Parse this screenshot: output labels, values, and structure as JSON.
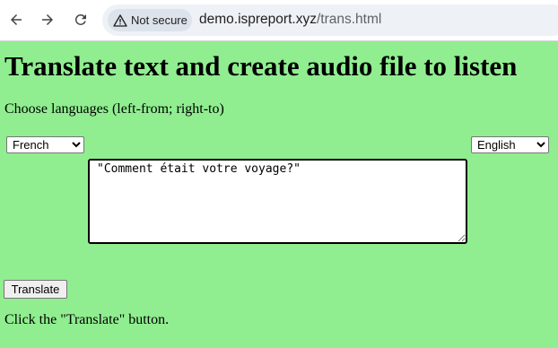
{
  "browser": {
    "security_label": "Not secure",
    "url_domain": "demo.ispreport.xyz",
    "url_path": "/trans.html"
  },
  "page": {
    "title": "Translate text and create audio file to listen",
    "instructions": "Choose languages (left-from; right-to)",
    "from_language": "French",
    "to_language": "English",
    "input_text": "\"Comment était votre voyage?\"",
    "translate_label": "Translate",
    "status_text": "Click the \"Translate\" button."
  }
}
